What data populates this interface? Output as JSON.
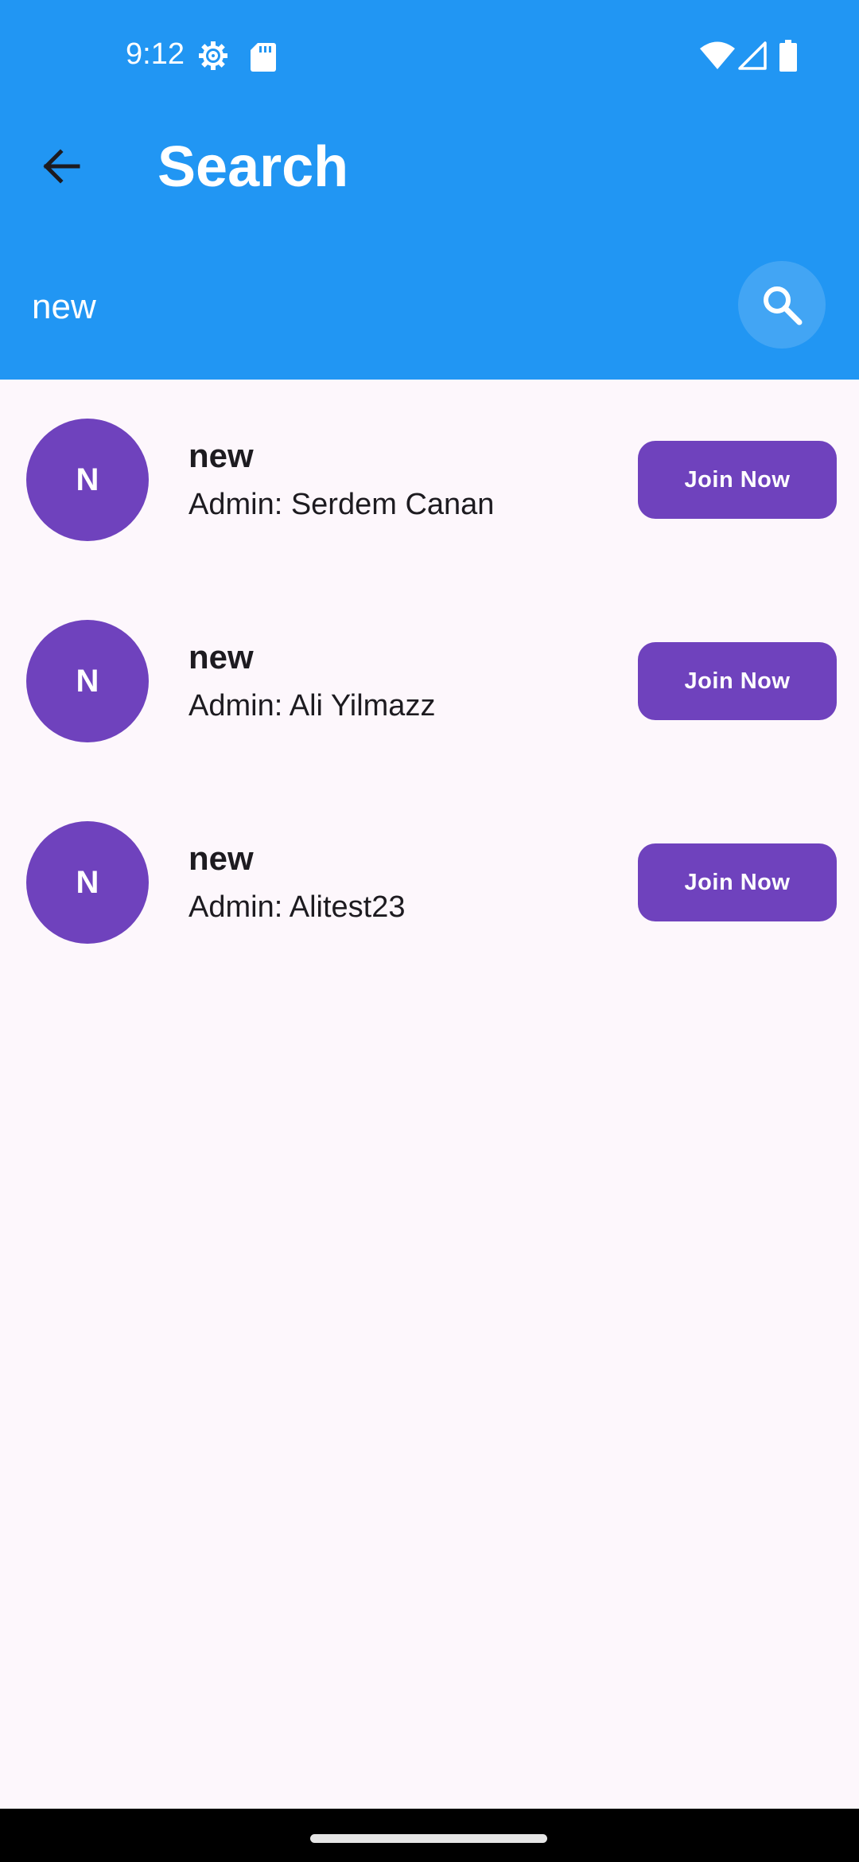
{
  "status_bar": {
    "time": "9:12",
    "icons": [
      "settings-gear-icon",
      "sd-card-icon",
      "wifi-icon",
      "cell-signal-icon",
      "battery-icon"
    ]
  },
  "app_bar": {
    "title": "Search",
    "back_icon": "arrow-left-icon"
  },
  "search": {
    "value": "new",
    "button_icon": "search-icon"
  },
  "results": [
    {
      "initial": "N",
      "name": "new",
      "admin": "Admin: Serdem Canan",
      "action": "Join Now"
    },
    {
      "initial": "N",
      "name": "new",
      "admin": "Admin: Ali Yilmazz",
      "action": "Join Now"
    },
    {
      "initial": "N",
      "name": "new",
      "admin": "Admin: Alitest23",
      "action": "Join Now"
    }
  ],
  "colors": {
    "header": "#2196f3",
    "accent": "#6f42bd",
    "background": "#fdf7fc",
    "text": "#1d1b20"
  }
}
